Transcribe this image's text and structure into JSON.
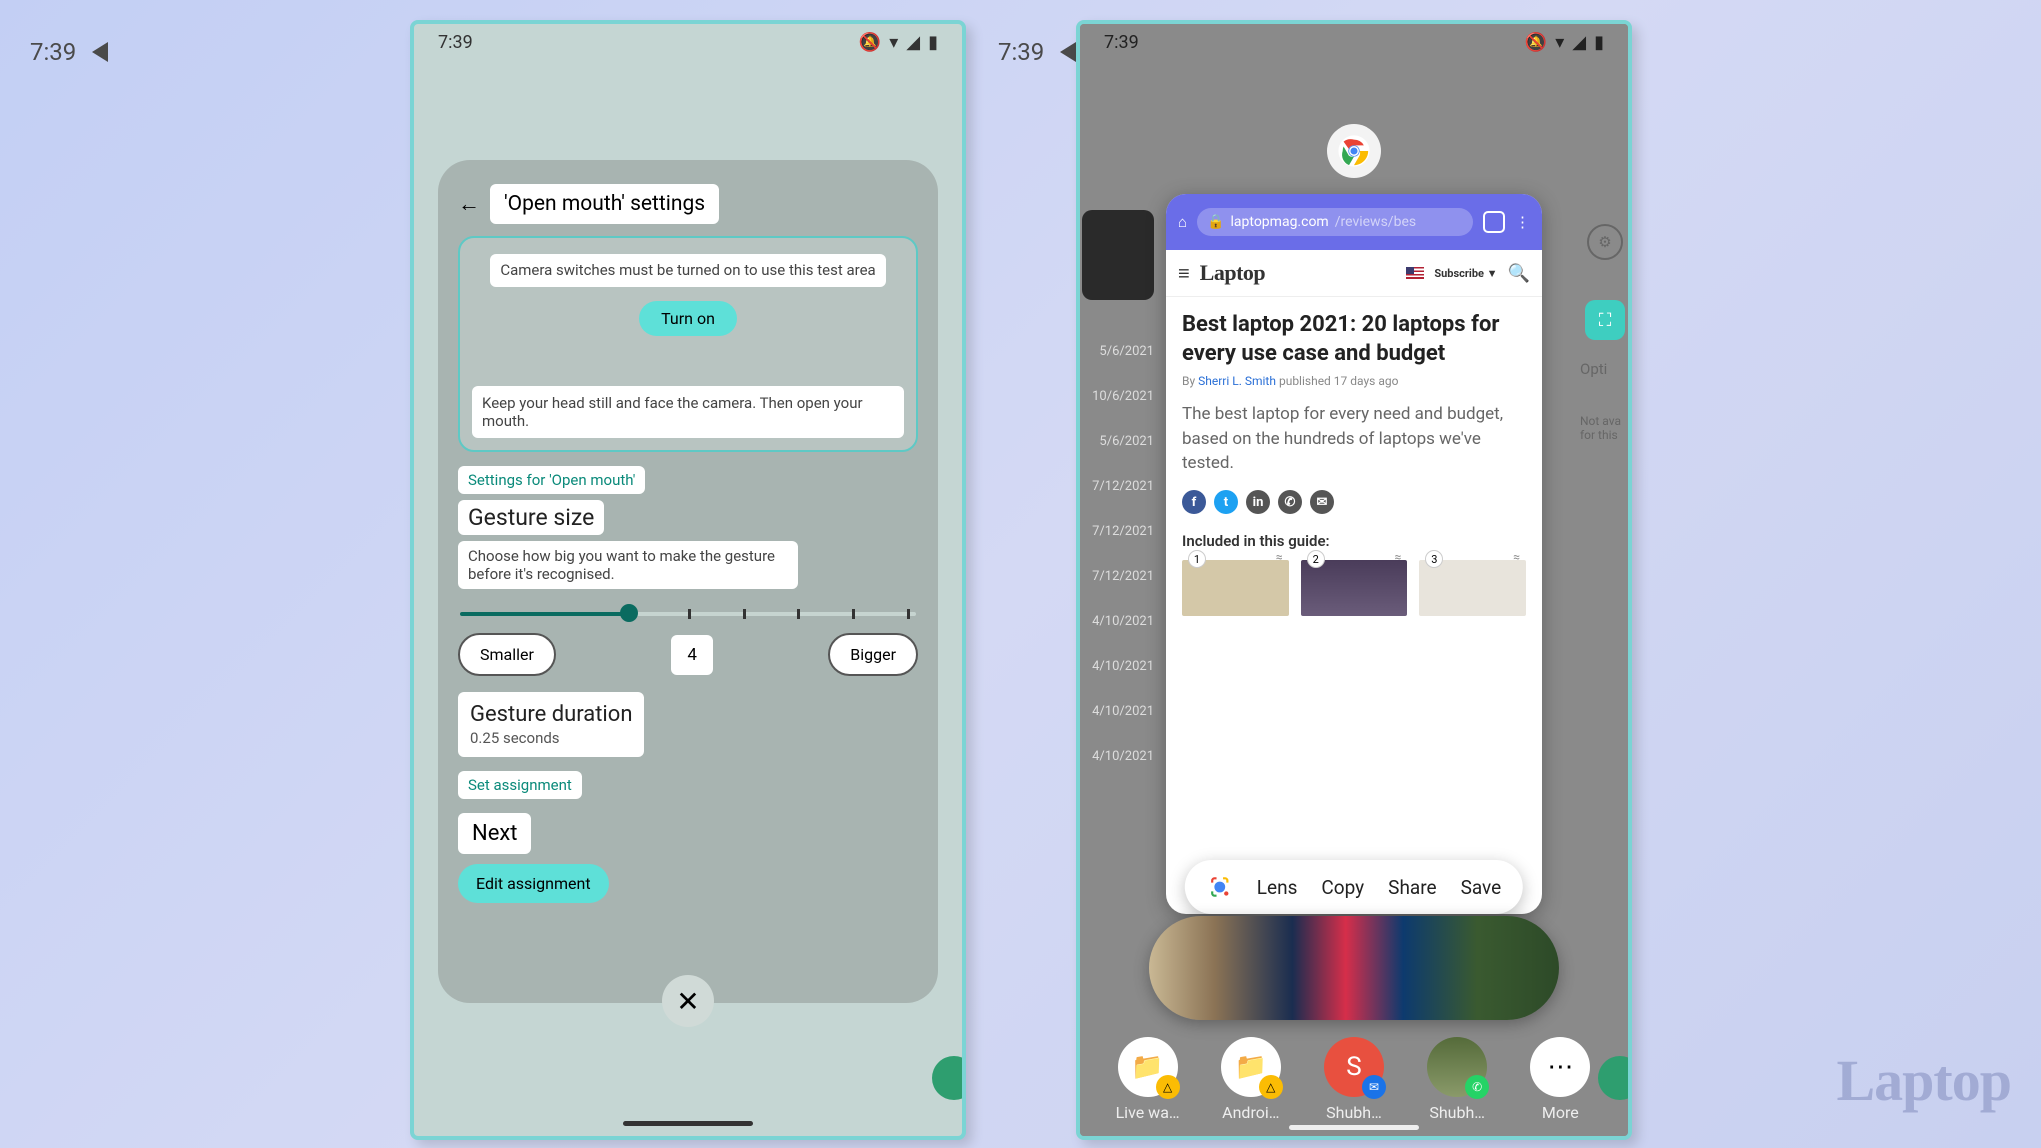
{
  "page_timestamp": "7:39",
  "status_bar": {
    "time": "7:39"
  },
  "watermark": "Laptop",
  "left_phone": {
    "title": "'Open mouth' settings",
    "test_area_msg": "Camera switches must be turned on to use this test area",
    "turn_on": "Turn on",
    "instruction": "Keep your head still and face the camera. Then open your mouth.",
    "settings_for": "Settings for 'Open mouth'",
    "gesture_size_title": "Gesture size",
    "gesture_size_desc": "Choose how big you want to make the gesture before it's recognised.",
    "slider": {
      "value": 4,
      "min": 1,
      "max": 9,
      "percent": 37
    },
    "smaller": "Smaller",
    "bigger": "Bigger",
    "duration_title": "Gesture duration",
    "duration_value": "0.25 seconds",
    "set_assignment": "Set assignment",
    "next": "Next",
    "edit_assignment": "Edit assignment"
  },
  "right_phone": {
    "sidebar_dates": [
      "5/6/2021",
      "10/6/2021",
      "5/6/2021",
      "7/12/2021",
      "7/12/2021",
      "7/12/2021",
      "4/10/2021",
      "4/10/2021",
      "4/10/2021",
      "4/10/2021"
    ],
    "sidebar_right": {
      "opti": "Opti",
      "not_avail": "Not ava\nfor this"
    },
    "browser": {
      "url_host": "laptopmag.com",
      "url_path": "/reviews/bes",
      "site_name": "Laptop",
      "subscribe": "Subscribe ▼",
      "article_title": "Best laptop 2021: 20 laptops for every use case and budget",
      "byline_prefix": "By ",
      "byline_author": "Sherri L. Smith",
      "byline_suffix": " published 17 days ago",
      "lede": "The best laptop for every need and budget, based on the hundreds of laptops we've tested.",
      "guide_label": "Included in this guide:",
      "thumbs": [
        "1",
        "2",
        "3"
      ]
    },
    "actions": {
      "lens": "Lens",
      "copy": "Copy",
      "share": "Share",
      "save": "Save"
    },
    "dock": [
      {
        "label": "Live wa…",
        "badge_color": "#fbbc04"
      },
      {
        "label": "Androi…",
        "badge_color": "#fbbc04"
      },
      {
        "label": "Shubh…",
        "circle": "S",
        "circle_bg": "#e8503f",
        "badge_color": "#1a73e8"
      },
      {
        "label": "Shubh…",
        "badge_color": "#25d366"
      },
      {
        "label": "More",
        "glyph": "⋯"
      }
    ]
  }
}
